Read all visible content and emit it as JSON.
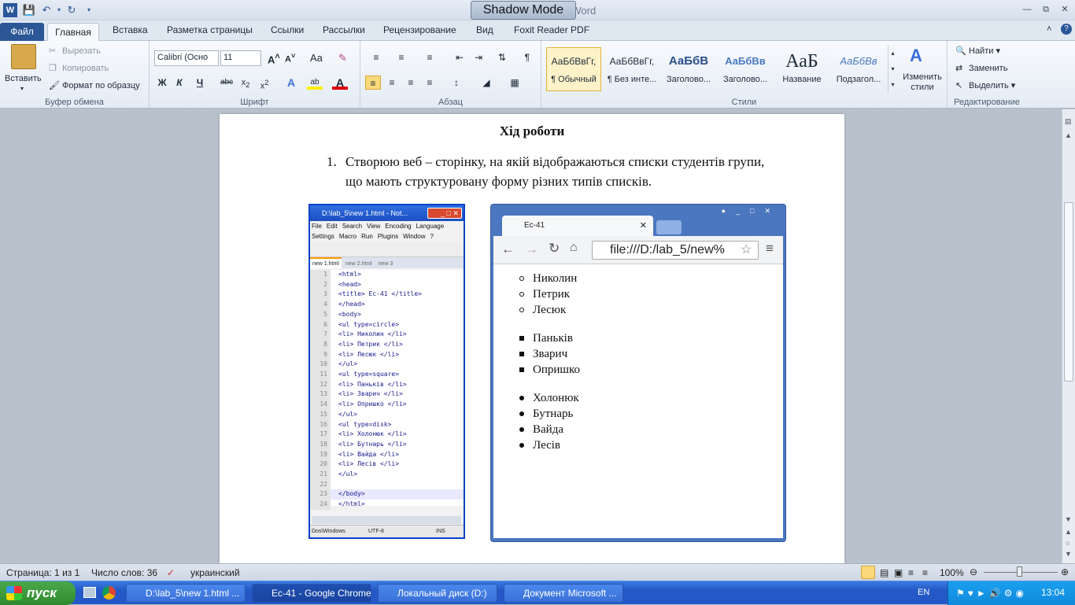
{
  "window": {
    "title": "Документ Microsoft Word",
    "shadow_button": "Shadow Mode"
  },
  "tabs": {
    "file": "Файл",
    "home": "Главная",
    "items": [
      "Вставка",
      "Разметка страницы",
      "Ссылки",
      "Рассылки",
      "Рецензирование",
      "Вид",
      "Foxit Reader PDF"
    ]
  },
  "ribbon": {
    "clipboard": {
      "paste": "Вставить",
      "cut": "Вырезать",
      "copy": "Копировать",
      "format_painter": "Формат по образцу",
      "label": "Буфер обмена"
    },
    "font": {
      "name": "Calibri (Осно",
      "size": "11",
      "label": "Шрифт",
      "case": "Aa"
    },
    "paragraph": {
      "label": "Абзац"
    },
    "styles": {
      "label": "Стили",
      "items": [
        {
          "preview": "АаБбВвГг,",
          "name": "¶ Обычный"
        },
        {
          "preview": "АаБбВвГг,",
          "name": "¶ Без инте..."
        },
        {
          "preview": "АаБбВ",
          "name": "Заголово..."
        },
        {
          "preview": "АаБбВв",
          "name": "Заголово..."
        },
        {
          "preview": "АаБ",
          "name": "Название"
        },
        {
          "preview": "АаБбВв",
          "name": "Подзагол..."
        }
      ],
      "change": "Изменить стили"
    },
    "editing": {
      "find": "Найти",
      "replace": "Заменить",
      "select": "Выделить",
      "label": "Редактирование"
    }
  },
  "document": {
    "heading": "Хід роботи",
    "item_number": "1.",
    "paragraph": "Створюю веб – сторінку, на якій відображаються списки студентів групи, що мають структуровану форму різних типів списків."
  },
  "npp": {
    "title": "D:\\lab_5\\new 1.html - Not...",
    "menu1": [
      "File",
      "Edit",
      "Search",
      "View",
      "Encoding",
      "Language"
    ],
    "menu2": [
      "Settings",
      "Macro",
      "Run",
      "Plugins",
      "Window",
      "?"
    ],
    "tabs": [
      "new 1.html",
      "new 2.html",
      "new 3"
    ],
    "lines": [
      {
        "n": "1",
        "code": "<html>"
      },
      {
        "n": "2",
        "code": "<head>"
      },
      {
        "n": "3",
        "code": "<title> Ec-41  </title>"
      },
      {
        "n": "4",
        "code": "</head>"
      },
      {
        "n": "5",
        "code": "<body>"
      },
      {
        "n": "6",
        "code": "<ul type=circle>"
      },
      {
        "n": "7",
        "code": "<li> Николин </li>"
      },
      {
        "n": "8",
        "code": "<li> Петрик </li>"
      },
      {
        "n": "9",
        "code": "<li> Лесюк </li>"
      },
      {
        "n": "10",
        "code": "</ul>"
      },
      {
        "n": "11",
        "code": "<ul type=square>"
      },
      {
        "n": "12",
        "code": "<li> Паньків </li>"
      },
      {
        "n": "13",
        "code": "<li> Зварич </li>"
      },
      {
        "n": "14",
        "code": "<li> Опришко </li>"
      },
      {
        "n": "15",
        "code": "</ul>"
      },
      {
        "n": "16",
        "code": "<ul type=disk>"
      },
      {
        "n": "17",
        "code": "<li> Холонюк </li>"
      },
      {
        "n": "18",
        "code": "<li> Бутнарь </li>"
      },
      {
        "n": "19",
        "code": "<li> Вайда </li>"
      },
      {
        "n": "20",
        "code": "<li> Лесів </li>"
      },
      {
        "n": "21",
        "code": "</ul>"
      },
      {
        "n": "22",
        "code": ""
      },
      {
        "n": "23",
        "code": "</body>"
      },
      {
        "n": "24",
        "code": "</html>"
      }
    ],
    "status": [
      "Dos\\Windows",
      "UTF-8",
      "INS"
    ]
  },
  "chrome": {
    "tab_title": "Ec-41",
    "url": "file:///D:/lab_5/new%",
    "list_circle": [
      "Николин",
      "Петрик",
      "Лесюк"
    ],
    "list_square": [
      "Паньків",
      "Зварич",
      "Опришко"
    ],
    "list_disc": [
      "Холонюк",
      "Бутнарь",
      "Вайда",
      "Лесів"
    ]
  },
  "statusbar": {
    "page": "Страница: 1 из 1",
    "words": "Число слов: 36",
    "language": "украинский",
    "zoom": "100%"
  },
  "taskbar": {
    "start": "пуск",
    "tasks": [
      "D:\\lab_5\\new 1.html ...",
      "Ec-41 - Google Chrome",
      "Локальный диск (D:)",
      "Документ Microsoft ..."
    ],
    "lang": "EN",
    "clock": "13:04"
  }
}
